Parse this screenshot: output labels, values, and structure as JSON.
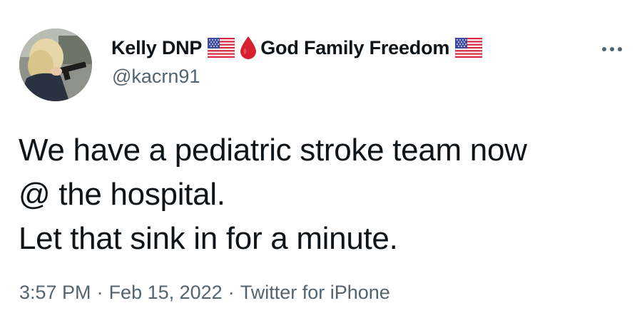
{
  "tweet": {
    "author": {
      "name_part1": "Kelly DNP",
      "name_part2": "God Family Freedom",
      "emojis": [
        "us-flag-icon",
        "blood-drop-icon",
        "us-flag-icon"
      ],
      "handle": "@kacrn91"
    },
    "text_lines": [
      "We have a pediatric stroke team now",
      "@ the hospital.",
      "Let that sink in for a minute."
    ],
    "meta": {
      "time": "3:57 PM",
      "separator": "·",
      "date": "Feb 15, 2022",
      "source": "Twitter for iPhone"
    }
  },
  "colors": {
    "primary_text": "#0f1419",
    "secondary_text": "#536471",
    "drop_red": "#d71f2f"
  }
}
